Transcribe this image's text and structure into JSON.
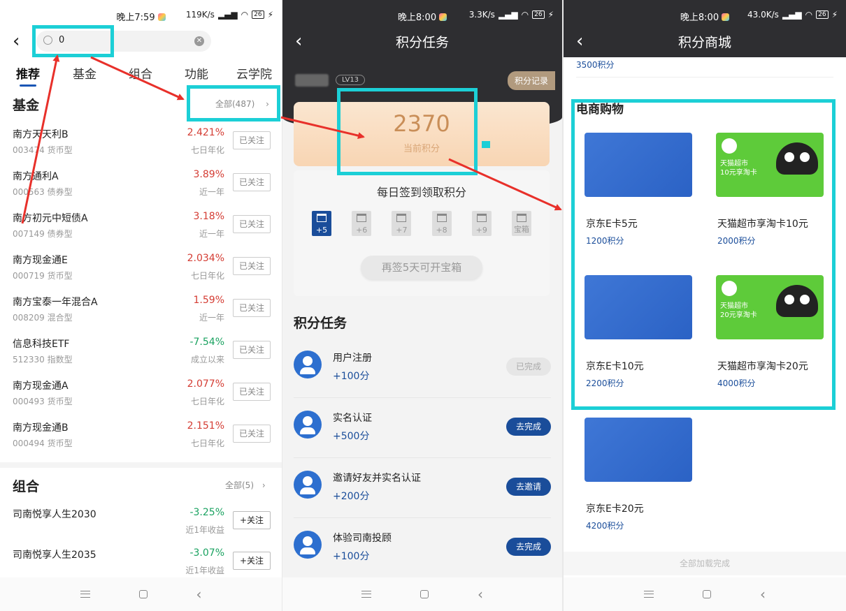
{
  "panel1": {
    "status": {
      "time": "晚上7:59",
      "speed": "119K/s",
      "battery": "26"
    },
    "search": {
      "value": "0"
    },
    "tabs": [
      "推荐",
      "基金",
      "组合",
      "功能",
      "云学院"
    ],
    "funds_section": {
      "title": "基金",
      "all": "全部(487)"
    },
    "funds": [
      {
        "name": "南方天天利B",
        "code": "003474 货币型",
        "value": "2.421%",
        "desc": "七日年化",
        "btn": "已关注",
        "tone": "red"
      },
      {
        "name": "南方通利A",
        "code": "000563 债券型",
        "value": "3.89%",
        "desc": "近一年",
        "btn": "已关注",
        "tone": "red"
      },
      {
        "name": "南方初元中短债A",
        "code": "007149 债券型",
        "value": "3.18%",
        "desc": "近一年",
        "btn": "已关注",
        "tone": "red"
      },
      {
        "name": "南方现金通E",
        "code": "000719 货币型",
        "value": "2.034%",
        "desc": "七日年化",
        "btn": "已关注",
        "tone": "red"
      },
      {
        "name": "南方宝泰一年混合A",
        "code": "008209 混合型",
        "value": "1.59%",
        "desc": "近一年",
        "btn": "已关注",
        "tone": "red"
      },
      {
        "name": "信息科技ETF",
        "code": "512330 指数型",
        "value": "-7.54%",
        "desc": "成立以来",
        "btn": "已关注",
        "tone": "green"
      },
      {
        "name": "南方现金通A",
        "code": "000493 货币型",
        "value": "2.077%",
        "desc": "七日年化",
        "btn": "已关注",
        "tone": "red"
      },
      {
        "name": "南方现金通B",
        "code": "000494 货币型",
        "value": "2.151%",
        "desc": "七日年化",
        "btn": "已关注",
        "tone": "red"
      }
    ],
    "combo_section": {
      "title": "组合",
      "all": "全部(5)"
    },
    "combos": [
      {
        "name": "司南悦享人生2030",
        "value": "-3.25%",
        "desc": "近1年收益",
        "btn": "+关注"
      },
      {
        "name": "司南悦享人生2035",
        "value": "-3.07%",
        "desc": "近1年收益",
        "btn": "+关注"
      }
    ]
  },
  "panel2": {
    "status": {
      "time": "晚上8:00",
      "speed": "3.3K/s",
      "battery": "26"
    },
    "title": "积分任务",
    "level": "LV13",
    "record": "积分记录",
    "points": "2370",
    "points_label": "当前积分",
    "sign_title": "每日签到领取积分",
    "days": [
      "+5",
      "+6",
      "+7",
      "+8",
      "+9",
      "宝箱"
    ],
    "sign_button": "再签5天可开宝箱",
    "tasks_title": "积分任务",
    "tasks": [
      {
        "name": "用户注册",
        "points": "+100分",
        "btn": "已完成",
        "done": true
      },
      {
        "name": "实名认证",
        "points": "+500分",
        "btn": "去完成",
        "done": false
      },
      {
        "name": "邀请好友并实名认证",
        "points": "+200分",
        "btn": "去邀请",
        "done": false
      },
      {
        "name": "体验司南投顾",
        "points": "+100分",
        "btn": "去完成",
        "done": false
      }
    ]
  },
  "panel3": {
    "status": {
      "time": "晚上8:00",
      "speed": "43.0K/s",
      "battery": "26"
    },
    "title": "积分商城",
    "top_item_points": "3500积分",
    "section": "电商购物",
    "products": [
      {
        "name": "京东E卡5元",
        "points": "1200积分",
        "kind": "jd"
      },
      {
        "name": "天猫超市享淘卡10元",
        "points": "2000积分",
        "kind": "tm",
        "card_text": "天猫超市\n10元享淘卡"
      },
      {
        "name": "京东E卡10元",
        "points": "2200积分",
        "kind": "jd"
      },
      {
        "name": "天猫超市享淘卡20元",
        "points": "4000积分",
        "kind": "tm",
        "card_text": "天猫超市\n20元享淘卡"
      },
      {
        "name": "京东E卡20元",
        "points": "4200积分",
        "kind": "jd"
      }
    ],
    "loaded": "全部加载完成"
  },
  "colors": {
    "highlight": "#1ccfd6",
    "arrow": "#e8302a",
    "brand_blue": "#1a4d9a"
  }
}
